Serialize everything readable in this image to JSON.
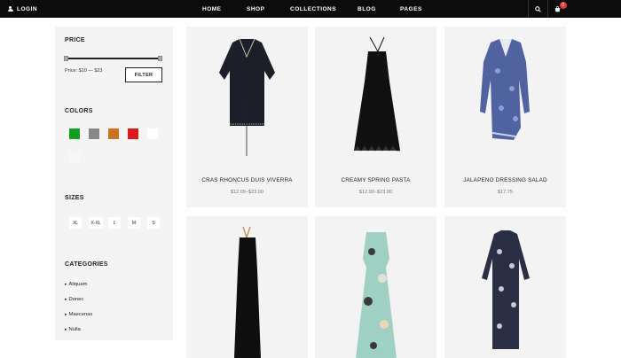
{
  "header": {
    "login_label": "LOGIN",
    "nav": [
      "HOME",
      "SHOP",
      "COLLECTIONS",
      "BLOG",
      "PAGES"
    ],
    "cart_count": "0"
  },
  "sidebar": {
    "price_title": "PRICE",
    "price_range_text": "Price: $10 — $23",
    "price_min_fraction": 0.0,
    "price_max_fraction": 1.0,
    "filter_label": "FILTER",
    "colors_title": "COLORS",
    "colors": [
      "#10a020",
      "#888888",
      "#d0701a",
      "#e01818",
      "#ffffff",
      "#f7f7f7"
    ],
    "sizes_title": "SIZES",
    "sizes": [
      "XL",
      "X-XL",
      "L",
      "M",
      "S"
    ],
    "categories_title": "CATEGORIES",
    "categories": [
      "Aliquam",
      "Donec",
      "Maecenas",
      "Nulla"
    ]
  },
  "products": [
    {
      "name": "CRAS RHONCUS DUIS VIVERRA",
      "price": "$12.00–$23.00",
      "dress_color": "#1c1e2a"
    },
    {
      "name": "CREAMY SPRING PASTA",
      "price": "$12.00–$23.00",
      "dress_color": "#111111"
    },
    {
      "name": "JALAPENO DRESSING SALAD",
      "price": "$17.75",
      "dress_color": "#4f63a0"
    },
    {
      "name": "",
      "price": "",
      "dress_color": "#0f0f0f"
    },
    {
      "name": "",
      "price": "",
      "dress_color": "#9fd0c4"
    },
    {
      "name": "",
      "price": "",
      "dress_color": "#2a2f45"
    }
  ]
}
